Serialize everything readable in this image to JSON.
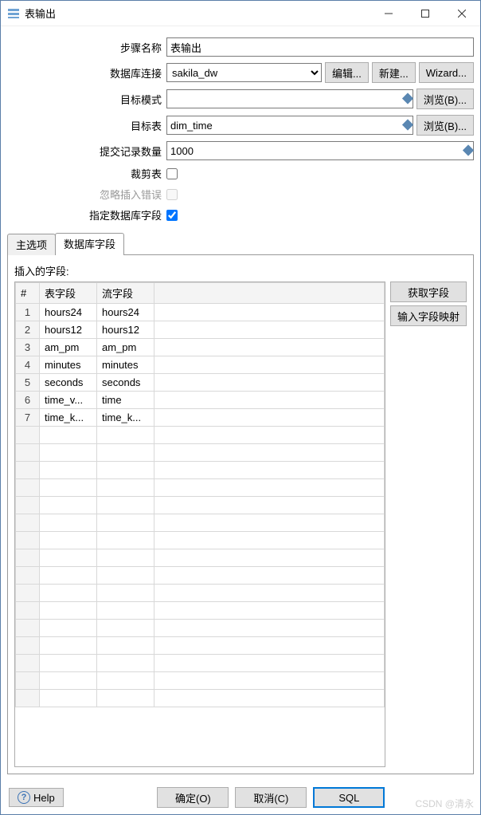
{
  "window": {
    "title": "表输出"
  },
  "form": {
    "step_name": {
      "label": "步骤名称",
      "value": "表输出"
    },
    "connection": {
      "label": "数据库连接",
      "value": "sakila_dw",
      "edit_btn": "编辑...",
      "new_btn": "新建...",
      "wizard_btn": "Wizard..."
    },
    "target_schema": {
      "label": "目标模式",
      "value": "",
      "browse_btn": "浏览(B)..."
    },
    "target_table": {
      "label": "目标表",
      "value": "dim_time",
      "browse_btn": "浏览(B)..."
    },
    "commit_size": {
      "label": "提交记录数量",
      "value": "1000"
    },
    "truncate": {
      "label": "裁剪表",
      "checked": false
    },
    "ignore_insert_errors": {
      "label": "忽略插入错误",
      "checked": false
    },
    "specify_fields": {
      "label": "指定数据库字段",
      "checked": true
    }
  },
  "tabs": {
    "main": "主选项",
    "fields": "数据库字段"
  },
  "fields_panel": {
    "insert_label": "插入的字段:",
    "col_num": "#",
    "col_table_field": "表字段",
    "col_stream_field": "流字段",
    "get_fields_btn": "获取字段",
    "map_fields_btn": "输入字段映射",
    "rows": [
      {
        "n": "1",
        "table_field": "hours24",
        "stream_field": "hours24"
      },
      {
        "n": "2",
        "table_field": "hours12",
        "stream_field": "hours12"
      },
      {
        "n": "3",
        "table_field": "am_pm",
        "stream_field": "am_pm"
      },
      {
        "n": "4",
        "table_field": "minutes",
        "stream_field": "minutes"
      },
      {
        "n": "5",
        "table_field": "seconds",
        "stream_field": "seconds"
      },
      {
        "n": "6",
        "table_field": "time_v...",
        "stream_field": "time"
      },
      {
        "n": "7",
        "table_field": "time_k...",
        "stream_field": "time_k..."
      }
    ]
  },
  "footer": {
    "help": "Help",
    "ok": "确定(O)",
    "cancel": "取消(C)",
    "sql": "SQL"
  },
  "watermark": "CSDN @清永"
}
